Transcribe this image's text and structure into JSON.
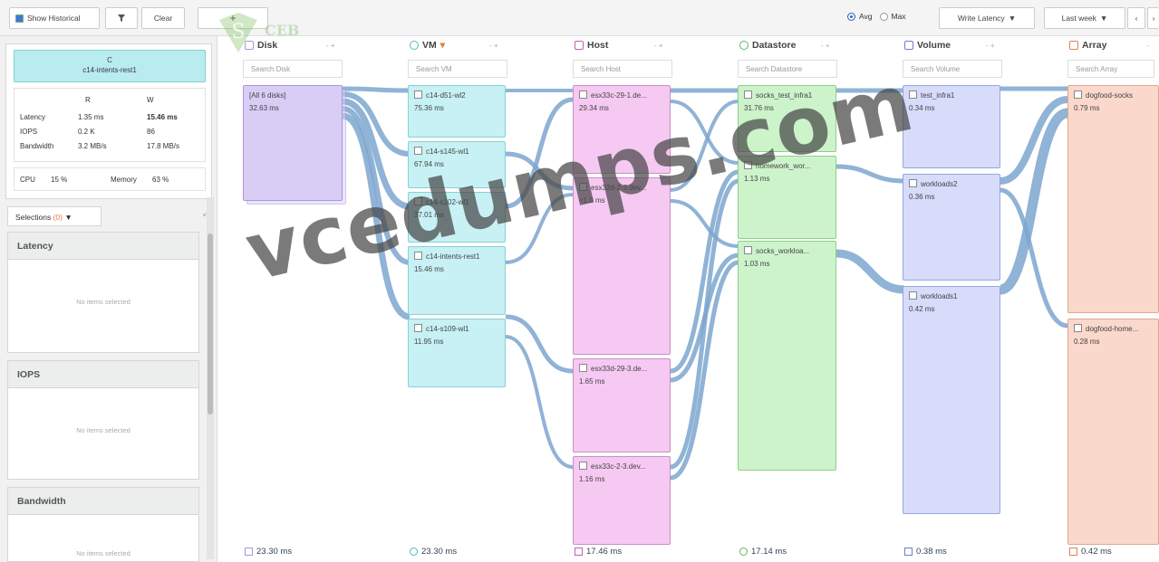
{
  "toolbar": {
    "show_historical": "Show Historical",
    "clear": "Clear",
    "avg": "Avg",
    "max": "Max",
    "metric": "Write Latency",
    "range": "Last week"
  },
  "watermark": {
    "brand": "CEB",
    "site": "vcedumps.com"
  },
  "sidebar": {
    "entity_type": "C",
    "entity_name": "c14-intents-rest1",
    "stats": {
      "col_r": "R",
      "col_w": "W",
      "rows": [
        {
          "label": "Latency",
          "r": "1.35 ms",
          "w": "15.46 ms"
        },
        {
          "label": "IOPS",
          "r": "0.2 K",
          "w": "86"
        },
        {
          "label": "Bandwidth",
          "r": "3.2 MB/s",
          "w": "17.8 MB/s"
        }
      ],
      "cpu_label": "CPU",
      "cpu_value": "15 %",
      "mem_label": "Memory",
      "mem_value": "63 %"
    },
    "selections_label": "Selections",
    "selections_count": "(0)",
    "panels": [
      {
        "title": "Latency",
        "empty": "No items selected"
      },
      {
        "title": "IOPS",
        "empty": "No items selected"
      },
      {
        "title": "Bandwidth",
        "empty": "No items selected"
      }
    ]
  },
  "columns": [
    {
      "title": "Disk",
      "search": "Search Disk",
      "total": "23.30 ms",
      "color": "#a897dc"
    },
    {
      "title": "VM",
      "search": "Search VM",
      "total": "23.30 ms",
      "color": "#58b6c0"
    },
    {
      "title": "Host",
      "search": "Search Host",
      "total": "17.46 ms",
      "color": "#c060b0"
    },
    {
      "title": "Datastore",
      "search": "Search Datastore",
      "total": "17.14 ms",
      "color": "#5cb85c"
    },
    {
      "title": "Volume",
      "search": "Search Volume",
      "total": "0.38 ms",
      "color": "#6a7fd0"
    },
    {
      "title": "Array",
      "search": "Search Array",
      "total": "0.42 ms",
      "color": "#e08060"
    }
  ],
  "nodes": {
    "disk": [
      {
        "name": "[All 6 disks]",
        "value": "32.63 ms"
      }
    ],
    "vm": [
      {
        "name": "c14-d51-wl2",
        "value": "75.36 ms"
      },
      {
        "name": "c14-s145-wl1",
        "value": "67.94 ms"
      },
      {
        "name": "c14-s102-wl1",
        "value": "37.01 ms"
      },
      {
        "name": "c14-intents-rest1",
        "value": "15.46 ms"
      },
      {
        "name": "c14-s109-wl1",
        "value": "11.95 ms"
      }
    ],
    "host": [
      {
        "name": "esx33c-29-1.de...",
        "value": "29.34 ms"
      },
      {
        "name": "esx33d-2-3.dev...",
        "value": "<1.0 ms"
      },
      {
        "name": "esx33d-29-3.de...",
        "value": "1.65 ms"
      },
      {
        "name": "esx33c-2-3.dev...",
        "value": "1.16 ms"
      }
    ],
    "datastore": [
      {
        "name": "socks_test_infra1",
        "value": "31.76 ms"
      },
      {
        "name": "homework_wor...",
        "value": "1.13 ms"
      },
      {
        "name": "socks_workloa...",
        "value": "1.03 ms"
      }
    ],
    "volume": [
      {
        "name": "test_infra1",
        "value": "0.34 ms"
      },
      {
        "name": "workloads2",
        "value": "0.36 ms"
      },
      {
        "name": "workloads1",
        "value": "0.42 ms"
      }
    ],
    "array": [
      {
        "name": "dogfood-socks",
        "value": "0.79 ms"
      },
      {
        "name": "dogfood-home...",
        "value": "0.28 ms"
      }
    ]
  }
}
